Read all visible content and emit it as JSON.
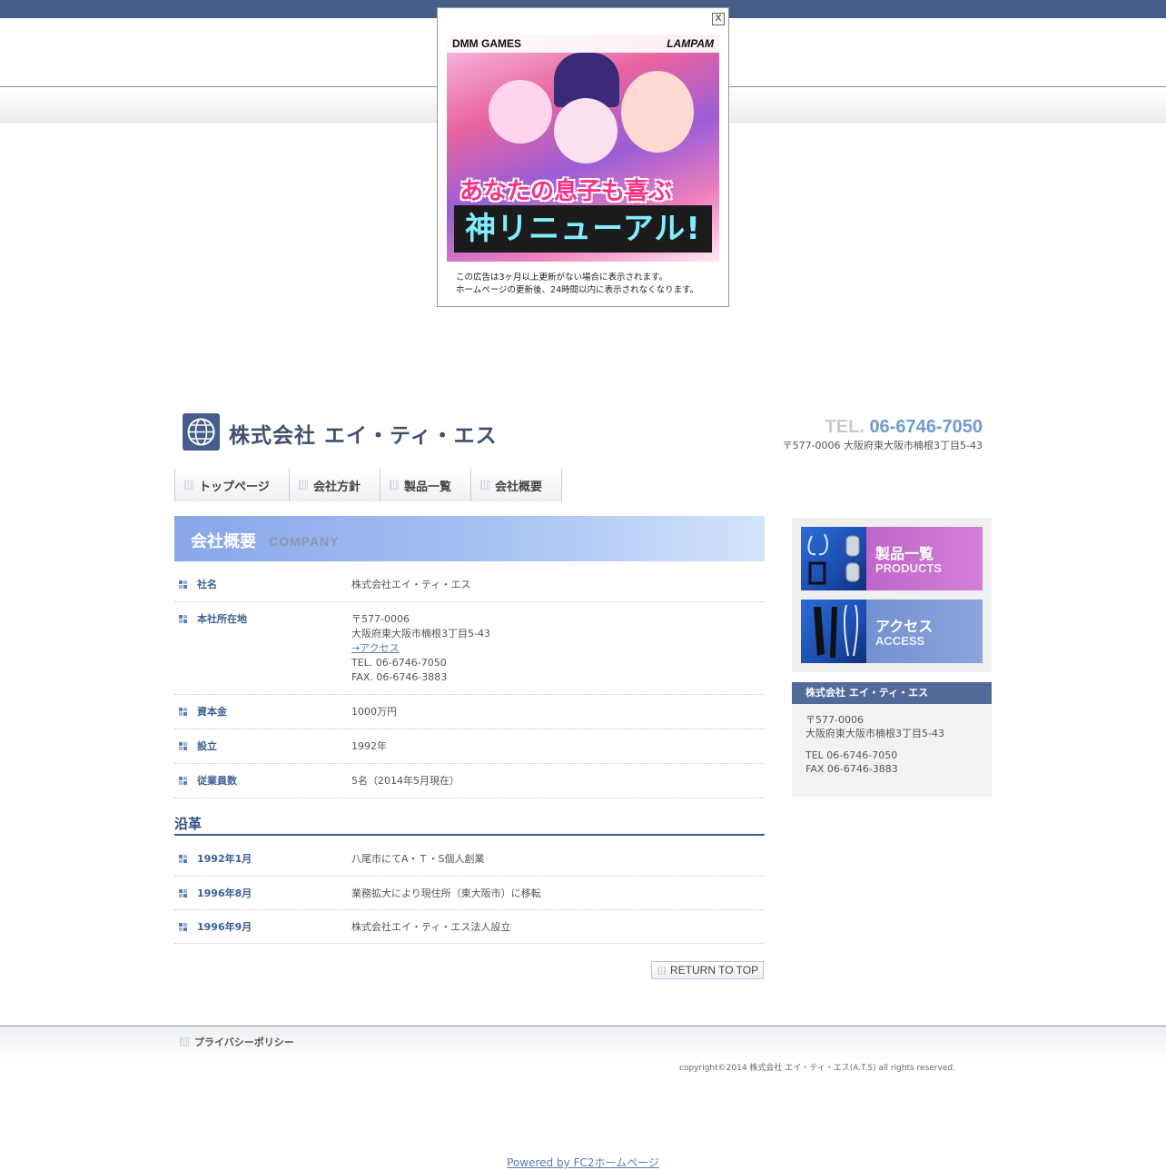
{
  "ad": {
    "close_label": "X",
    "brand_left": "DMM GAMES",
    "brand_right": "LAMPAM",
    "catch1": "あなたの息子も喜ぶ",
    "catch2": "神リニューアル!",
    "note_line1": "この広告は3ヶ月以上更新がない場合に表示されます。",
    "note_line2": "ホームページの更新後、24時間以内に表示されなくなります。"
  },
  "header": {
    "company_name": "株式会社 エイ・ティ・エス",
    "tel_label": "TEL.",
    "tel_number": "06-6746-7050",
    "address": "〒577-0006 大阪府東大阪市楠根3丁目5-43"
  },
  "nav": {
    "items": [
      {
        "label": "トップページ"
      },
      {
        "label": "会社方針"
      },
      {
        "label": "製品一覧"
      },
      {
        "label": "会社概要"
      }
    ]
  },
  "main": {
    "title_ja": "会社概要",
    "title_en": "COMPANY",
    "profile": [
      {
        "key": "社名",
        "value": "株式会社エイ・ティ・エス"
      },
      {
        "key": "本社所在地",
        "postal": "〒577-0006",
        "address": "大阪府東大阪市楠根3丁目5-43",
        "link": "→アクセス",
        "tel": "TEL. 06-6746-7050",
        "fax": "FAX. 06-6746-3883"
      },
      {
        "key": "資本金",
        "value": "1000万円"
      },
      {
        "key": "設立",
        "value": "1992年"
      },
      {
        "key": "従業員数",
        "value": "5名（2014年5月現在）"
      }
    ],
    "history_title": "沿革",
    "history": [
      {
        "date": "1992年1月",
        "event": "八尾市にてA・Ｔ・S個人創業"
      },
      {
        "date": "1996年8月",
        "event": "業務拡大により現住所（東大阪市）に移転"
      },
      {
        "date": "1996年9月",
        "event": "株式会社エイ・ティ・エス法人設立"
      }
    ],
    "return_to_top": "RETURN TO TOP"
  },
  "sidebar": {
    "banners": [
      {
        "title_ja": "製品一覧",
        "title_en": "PRODUCTS",
        "color": "#c066c8"
      },
      {
        "title_ja": "アクセス",
        "title_en": "ACCESS",
        "color": "#7391cf"
      }
    ],
    "info": {
      "heading": "株式会社 エイ・ティ・エス",
      "postal": "〒577-0006",
      "address": "大阪府東大阪市楠根3丁目5-43",
      "tel": "TEL 06-6746-7050",
      "fax": "FAX 06-6746-3883"
    }
  },
  "footer": {
    "privacy_link": "プライバシーポリシー",
    "copyright": "copyright©2014 株式会社 エイ・ティ・エス(A.T.S) all rights reserved.",
    "powered_by": "Powered by FC2ホームページ"
  },
  "colors": {
    "header_bar": "#465d8a",
    "accent_blue": "#3b5f98",
    "tel_blue": "#6f9ad0"
  }
}
